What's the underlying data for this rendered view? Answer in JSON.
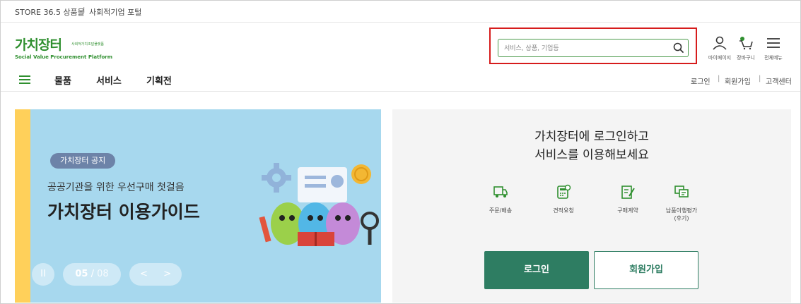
{
  "topbar": {
    "store_link": "STORE 36.5 상품몰",
    "separator": "I",
    "portal_link": "사회적기업 포털"
  },
  "logo": {
    "main": "가치장터",
    "sub_korean": "사회적가치조달플랫폼",
    "sub_english": "Social Value Procurement Platform"
  },
  "search": {
    "placeholder": "서비스, 상품, 기업등"
  },
  "utility": {
    "mypage": "마이페이지",
    "cart": "장바구니",
    "menu": "전체메뉴"
  },
  "nav": {
    "items": [
      "물품",
      "서비스",
      "기획전"
    ],
    "right": [
      "로그인",
      "회원가입",
      "고객센터"
    ],
    "separator": "|"
  },
  "banner": {
    "tag": "가치장터 공지",
    "subtitle": "공공기관을 위한 우선구매 첫걸음",
    "title": "가치장터 이용가이드",
    "current": "05",
    "divider": "/",
    "total": "08",
    "pause": "II",
    "prev": "<",
    "next": ">"
  },
  "login_panel": {
    "title_line1": "가치장터에 로그인하고",
    "title_line2": "서비스를 이용해보세요",
    "services": [
      {
        "icon": "truck-icon",
        "label": "주문/배송"
      },
      {
        "icon": "calculator-icon",
        "label": "견적요청"
      },
      {
        "icon": "contract-icon",
        "label": "구매계약"
      },
      {
        "icon": "review-icon",
        "label": "납품이행평가",
        "label2": "(후기)"
      }
    ],
    "login_button": "로그인",
    "join_button": "회원가입"
  },
  "colors": {
    "brand_green": "#2f8f2f",
    "button_green": "#2e7d62",
    "highlight_red": "#d61c1c",
    "banner_bg": "#a7d8ee"
  }
}
